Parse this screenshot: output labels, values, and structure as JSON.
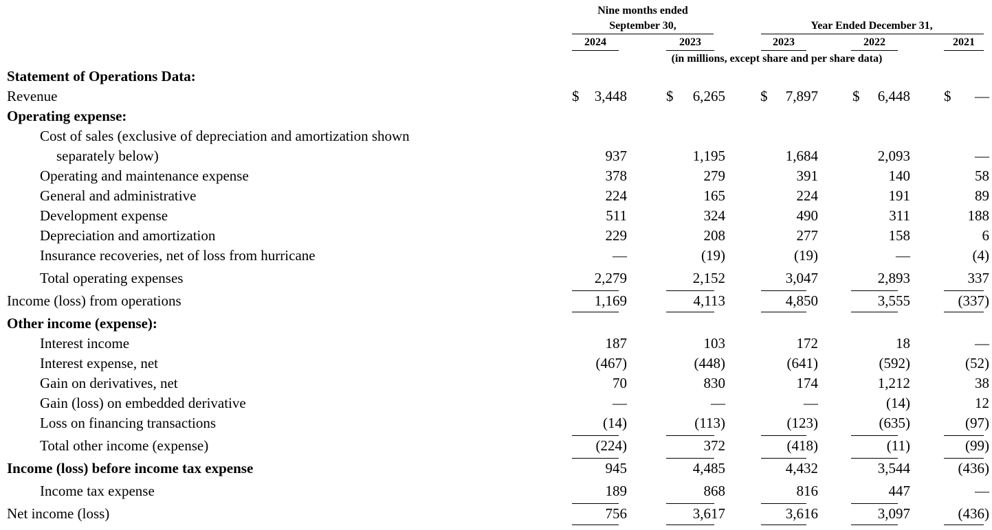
{
  "headers": {
    "group1_line1": "Nine months ended",
    "group1_line2": "September 30,",
    "group2": "Year Ended December 31,",
    "years": [
      "2024",
      "2023",
      "2023",
      "2022",
      "2021"
    ],
    "units_note": "(in millions, except share and per share data)"
  },
  "rows": [
    {
      "label": "Statement of Operations Data:",
      "style": "bold",
      "values": [
        "",
        "",
        "",
        "",
        ""
      ]
    },
    {
      "label": "Revenue",
      "style": "",
      "values": [
        "3,448",
        "6,265",
        "7,897",
        "6,448",
        "—"
      ],
      "currency": "$"
    },
    {
      "label": "Operating expense:",
      "style": "bold",
      "values": [
        "",
        "",
        "",
        "",
        ""
      ]
    },
    {
      "label": "Cost of sales (exclusive of depreciation and amortization shown",
      "style": "ind1",
      "values": [
        "",
        "",
        "",
        "",
        ""
      ]
    },
    {
      "label": "separately below)",
      "style": "ind2",
      "values": [
        "937",
        "1,195",
        "1,684",
        "2,093",
        "—"
      ]
    },
    {
      "label": "Operating and maintenance expense",
      "style": "ind1",
      "values": [
        "378",
        "279",
        "391",
        "140",
        "58"
      ]
    },
    {
      "label": "General and administrative",
      "style": "ind1",
      "values": [
        "224",
        "165",
        "224",
        "191",
        "89"
      ]
    },
    {
      "label": "Development expense",
      "style": "ind1",
      "values": [
        "511",
        "324",
        "490",
        "311",
        "188"
      ]
    },
    {
      "label": "Depreciation and amortization",
      "style": "ind1",
      "values": [
        "229",
        "208",
        "277",
        "158",
        "6"
      ]
    },
    {
      "label": "Insurance recoveries, net of loss from hurricane",
      "style": "ind1",
      "values": [
        "—",
        "(19)",
        "(19)",
        "—",
        "(4)"
      ]
    },
    {
      "label": "Total operating expenses",
      "style": "ind1",
      "values": [
        "2,279",
        "2,152",
        "3,047",
        "2,893",
        "337"
      ]
    },
    {
      "label": "Income (loss) from operations",
      "style": "",
      "values": [
        "1,169",
        "4,113",
        "4,850",
        "3,555",
        "(337)"
      ]
    },
    {
      "label": "Other income (expense):",
      "style": "bold",
      "values": [
        "",
        "",
        "",
        "",
        ""
      ]
    },
    {
      "label": "Interest income",
      "style": "ind1",
      "values": [
        "187",
        "103",
        "172",
        "18",
        "—"
      ]
    },
    {
      "label": "Interest expense, net",
      "style": "ind1",
      "values": [
        "(467)",
        "(448)",
        "(641)",
        "(592)",
        "(52)"
      ]
    },
    {
      "label": "Gain on derivatives, net",
      "style": "ind1",
      "values": [
        "70",
        "830",
        "174",
        "1,212",
        "38"
      ]
    },
    {
      "label": "Gain (loss) on embedded derivative",
      "style": "ind1",
      "values": [
        "—",
        "—",
        "—",
        "(14)",
        "12"
      ]
    },
    {
      "label": "Loss on financing transactions",
      "style": "ind1",
      "values": [
        "(14)",
        "(113)",
        "(123)",
        "(635)",
        "(97)"
      ]
    },
    {
      "label": "Total other income (expense)",
      "style": "ind1",
      "values": [
        "(224)",
        "372",
        "(418)",
        "(11)",
        "(99)"
      ]
    },
    {
      "label": "Income (loss) before income tax expense",
      "style": "bold",
      "values": [
        "945",
        "4,485",
        "4,432",
        "3,544",
        "(436)"
      ]
    },
    {
      "label": "Income tax expense",
      "style": "ind1",
      "values": [
        "189",
        "868",
        "816",
        "447",
        "—"
      ]
    },
    {
      "label": "Net income (loss)",
      "style": "",
      "values": [
        "756",
        "3,617",
        "3,616",
        "3,097",
        "(436)"
      ]
    }
  ]
}
